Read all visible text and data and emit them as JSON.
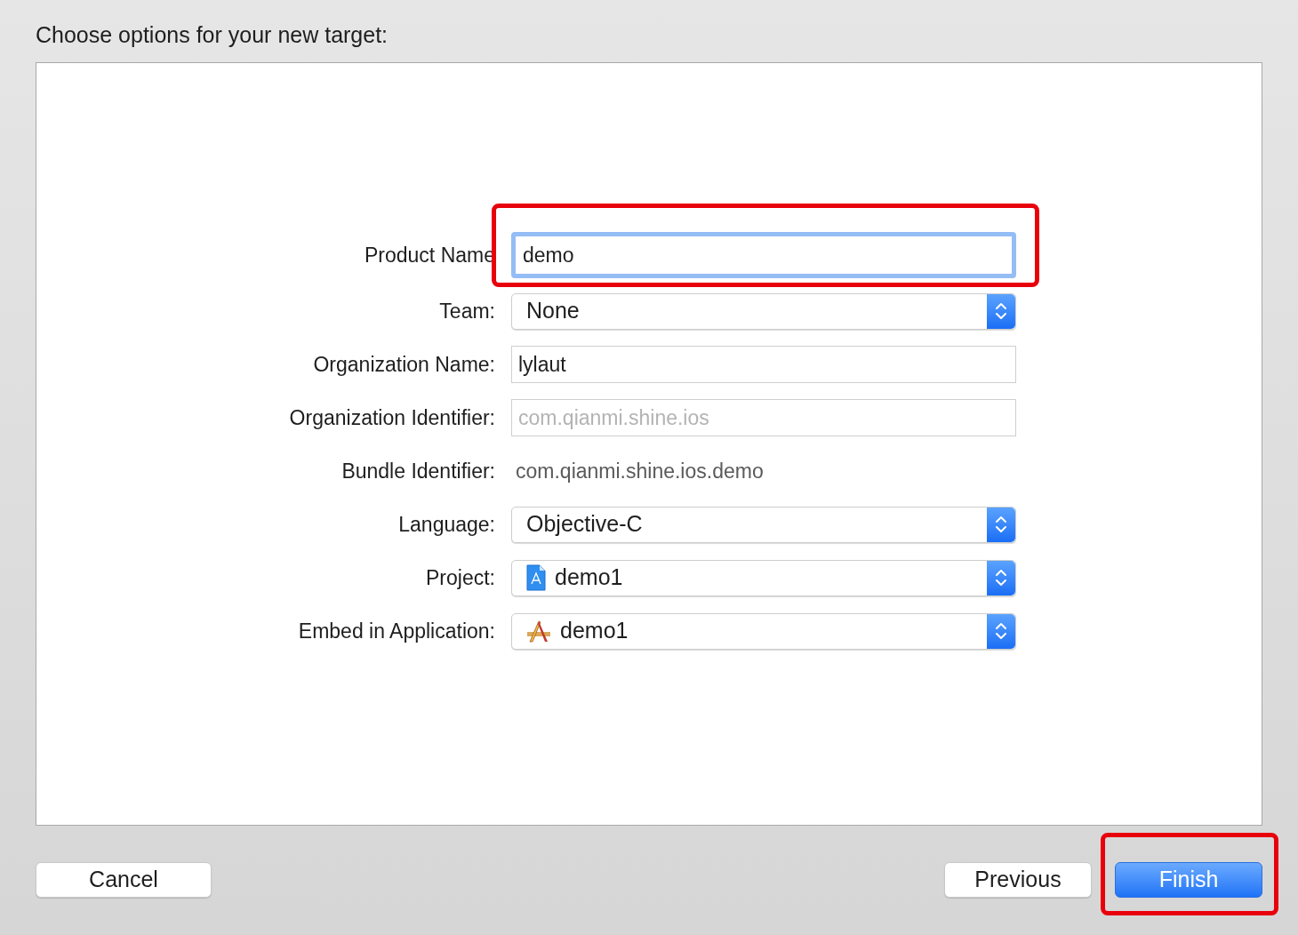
{
  "heading": "Choose options for your new target:",
  "fields": [
    {
      "kind": "text",
      "label": "Product Name",
      "value": "demo",
      "focused": true,
      "highlighted": true
    },
    {
      "kind": "popup",
      "label": "Team:",
      "value": "None"
    },
    {
      "kind": "text",
      "label": "Organization Name:",
      "value": "lylaut",
      "focused": false,
      "highlighted": false
    },
    {
      "kind": "text",
      "label": "Organization Identifier:",
      "placeholder": "com.qianmi.shine.ios",
      "focused": false,
      "highlighted": false
    },
    {
      "kind": "static",
      "label": "Bundle Identifier:",
      "value": "com.qianmi.shine.ios.demo"
    },
    {
      "kind": "popup",
      "label": "Language:",
      "value": "Objective-C"
    },
    {
      "kind": "project-popup",
      "label": "Project:",
      "value": "demo1"
    },
    {
      "kind": "app-popup",
      "label": "Embed in Application:",
      "value": "demo1"
    }
  ],
  "buttons": [
    {
      "label": "Cancel",
      "primary": false,
      "highlighted": false
    },
    {
      "label": "Previous",
      "primary": false,
      "highlighted": false
    },
    {
      "label": "Finish",
      "primary": true,
      "highlighted": true
    }
  ]
}
